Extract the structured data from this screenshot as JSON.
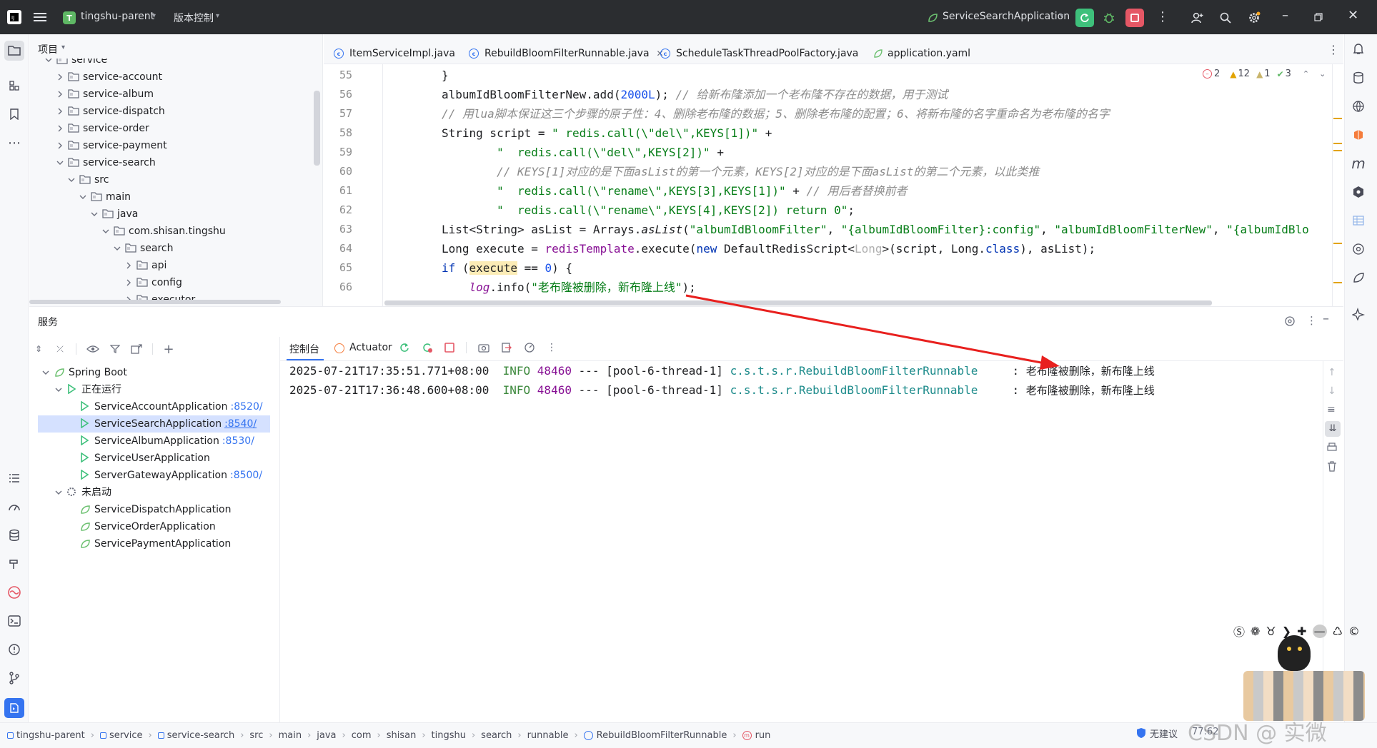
{
  "titlebar": {
    "project_badge": "T",
    "project_name": "tingshu-parent",
    "vcs_label": "版本控制",
    "run_config": "ServiceSearchApplication"
  },
  "project_panel": {
    "title": "项目",
    "items": [
      {
        "label": "service",
        "depth": 1
      },
      {
        "label": "service-account",
        "depth": 2
      },
      {
        "label": "service-album",
        "depth": 2
      },
      {
        "label": "service-dispatch",
        "depth": 2
      },
      {
        "label": "service-order",
        "depth": 2
      },
      {
        "label": "service-payment",
        "depth": 2
      },
      {
        "label": "service-search",
        "depth": 2
      },
      {
        "label": "src",
        "depth": 3
      },
      {
        "label": "main",
        "depth": 4
      },
      {
        "label": "java",
        "depth": 5
      },
      {
        "label": "com.shisan.tingshu",
        "depth": 6
      },
      {
        "label": "search",
        "depth": 7
      },
      {
        "label": "api",
        "depth": 8
      },
      {
        "label": "config",
        "depth": 8
      },
      {
        "label": "executor",
        "depth": 8
      }
    ]
  },
  "tabs": [
    {
      "label": "ItemServiceImpl.java"
    },
    {
      "label": "RebuildBloomFilterRunnable.java",
      "active": true
    },
    {
      "label": "ScheduleTaskThreadPoolFactory.java"
    },
    {
      "label": "application.yaml"
    }
  ],
  "inspections": {
    "errors": "2",
    "warnings": "12",
    "weak": "1",
    "typos": "3"
  },
  "editor": {
    "line_numbers": [
      "55",
      "56",
      "57",
      "58",
      "59",
      "60",
      "61",
      "62",
      "63",
      "64",
      "65",
      "66"
    ],
    "t": [
      "}",
      "albumIdBloomFilterNew.add(",
      "2000L",
      ");",
      "// 给新布隆添加一个老布隆不存在的数据，用于测试",
      "// 用lua脚本保证这三个步骤的原子性：4、删除老布隆的数据；5、删除老布隆的配置；6、将新布隆的名字重命名为老布隆的名字",
      "String script = ",
      "\" redis.call(\\\"del\\\",KEYS[1])\"",
      " +",
      "\"  redis.call(\\\"del\\\",KEYS[2])\"",
      " +",
      "// KEYS[1]对应的是下面asList的第一个元素，KEYS[2]对应的是下面asList的第二个元素，以此类推",
      "\"  redis.call(\\\"rename\\\",KEYS[3],KEYS[1])\"",
      " + ",
      "// 用后者替换前者",
      "\"  redis.call(\\\"rename\\\",KEYS[4],KEYS[2]) return 0\"",
      ";",
      "List<String> asList = Arrays.",
      "asList",
      "(",
      "\"albumIdBloomFilter\"",
      ", ",
      "\"{albumIdBloomFilter}:config\"",
      ", ",
      "\"albumIdBloomFilterNew\"",
      ", ",
      "\"{albumIdBlo",
      "Long execute = ",
      "redisTemplate",
      ".execute(",
      "new",
      " DefaultRedisScript<",
      "Long",
      ">(script, Long.",
      "class",
      "), asList);",
      "if",
      " (",
      "execute",
      " == ",
      "0",
      ") {",
      "log",
      ".info(",
      "\"老布隆被删除，新布隆上线\"",
      ");"
    ]
  },
  "services": {
    "title": "服务",
    "tree": {
      "root": "Spring Boot",
      "running_group": "正在运行",
      "running": [
        {
          "name": "ServiceAccountApplication",
          "port": ":8520/"
        },
        {
          "name": "ServiceSearchApplication",
          "port": ":8540/",
          "selected": true
        },
        {
          "name": "ServiceAlbumApplication",
          "port": ":8530/"
        },
        {
          "name": "ServiceUserApplication",
          "port": ""
        },
        {
          "name": "ServerGatewayApplication",
          "port": ":8500/"
        }
      ],
      "stopped_group": "未启动",
      "stopped": [
        {
          "name": "ServiceDispatchApplication"
        },
        {
          "name": "ServiceOrderApplication"
        },
        {
          "name": "ServicePaymentApplication"
        }
      ]
    },
    "console_tab": "控制台",
    "actuator_tab": "Actuator",
    "logs": [
      {
        "ts": "2025-07-21T17:35:51.771+08:00",
        "level": "INFO",
        "pid": "48460",
        "sep": "---",
        "thread": "[pool-6-thread-1]",
        "logger": "c.s.t.s.r.RebuildBloomFilterRunnable",
        "msg": "老布隆被删除，新布隆上线"
      },
      {
        "ts": "2025-07-21T17:36:48.600+08:00",
        "level": "INFO",
        "pid": "48460",
        "sep": "---",
        "thread": "[pool-6-thread-1]",
        "logger": "c.s.t.s.r.RebuildBloomFilterRunnable",
        "msg": "老布隆被删除，新布隆上线"
      }
    ]
  },
  "breadcrumb": [
    "tingshu-parent",
    "service",
    "service-search",
    "src",
    "main",
    "java",
    "com",
    "shisan",
    "tingshu",
    "search",
    "runnable",
    "RebuildBloomFilterRunnable",
    "run"
  ],
  "statusbar": {
    "suggest": "无建议",
    "position": "77:62"
  },
  "watermark": "CSDN @ 实微",
  "colors": {
    "accent": "#3574f0",
    "title_bg": "#2b2d30",
    "run_green": "#3ec07b",
    "stop_red": "#e55765",
    "arrow_red": "#e8201e"
  }
}
